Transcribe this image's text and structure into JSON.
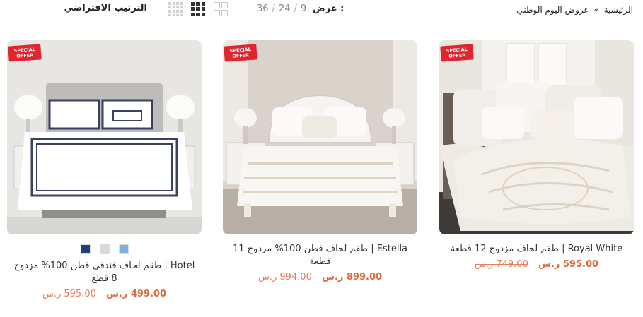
{
  "breadcrumb": {
    "home": "الرئيسية",
    "separator": "»",
    "current": "عروض اليوم الوطني"
  },
  "per_page": {
    "label": "عرض :",
    "options": [
      "9",
      "24",
      "36"
    ],
    "separator": "/"
  },
  "grid_view": {
    "icons": [
      "grid-4-icon",
      "grid-3-icon",
      "grid-2-icon"
    ],
    "active": "grid-3-icon"
  },
  "sort": {
    "selected": "الترتيب الافتراضي"
  },
  "badge": {
    "line1": "SPECIAL",
    "line2": "OFFER"
  },
  "products": [
    {
      "title": "Royal White | طقم لحاف مزدوج 12 قطعة",
      "price_new": "595.00 ر.س",
      "price_old": "749.00 ر.س"
    },
    {
      "title": "Estella | طقم لحاف قطن 100% مزدوج 11 قطعة",
      "price_new": "899.00 ر.س",
      "price_old": "994.00 ر.س"
    },
    {
      "title": "Hotel | طقم لحاف فندقي قطن 100% مزدوج 8 قطع",
      "price_new": "499.00 ر.س",
      "price_old": "595.00 ر.س",
      "swatch_colors": [
        "#7fb1e0",
        "#d9d9d9",
        "#1f3f78"
      ]
    }
  ],
  "colors": {
    "price": "#e0683f",
    "badge": "#e1252e"
  }
}
